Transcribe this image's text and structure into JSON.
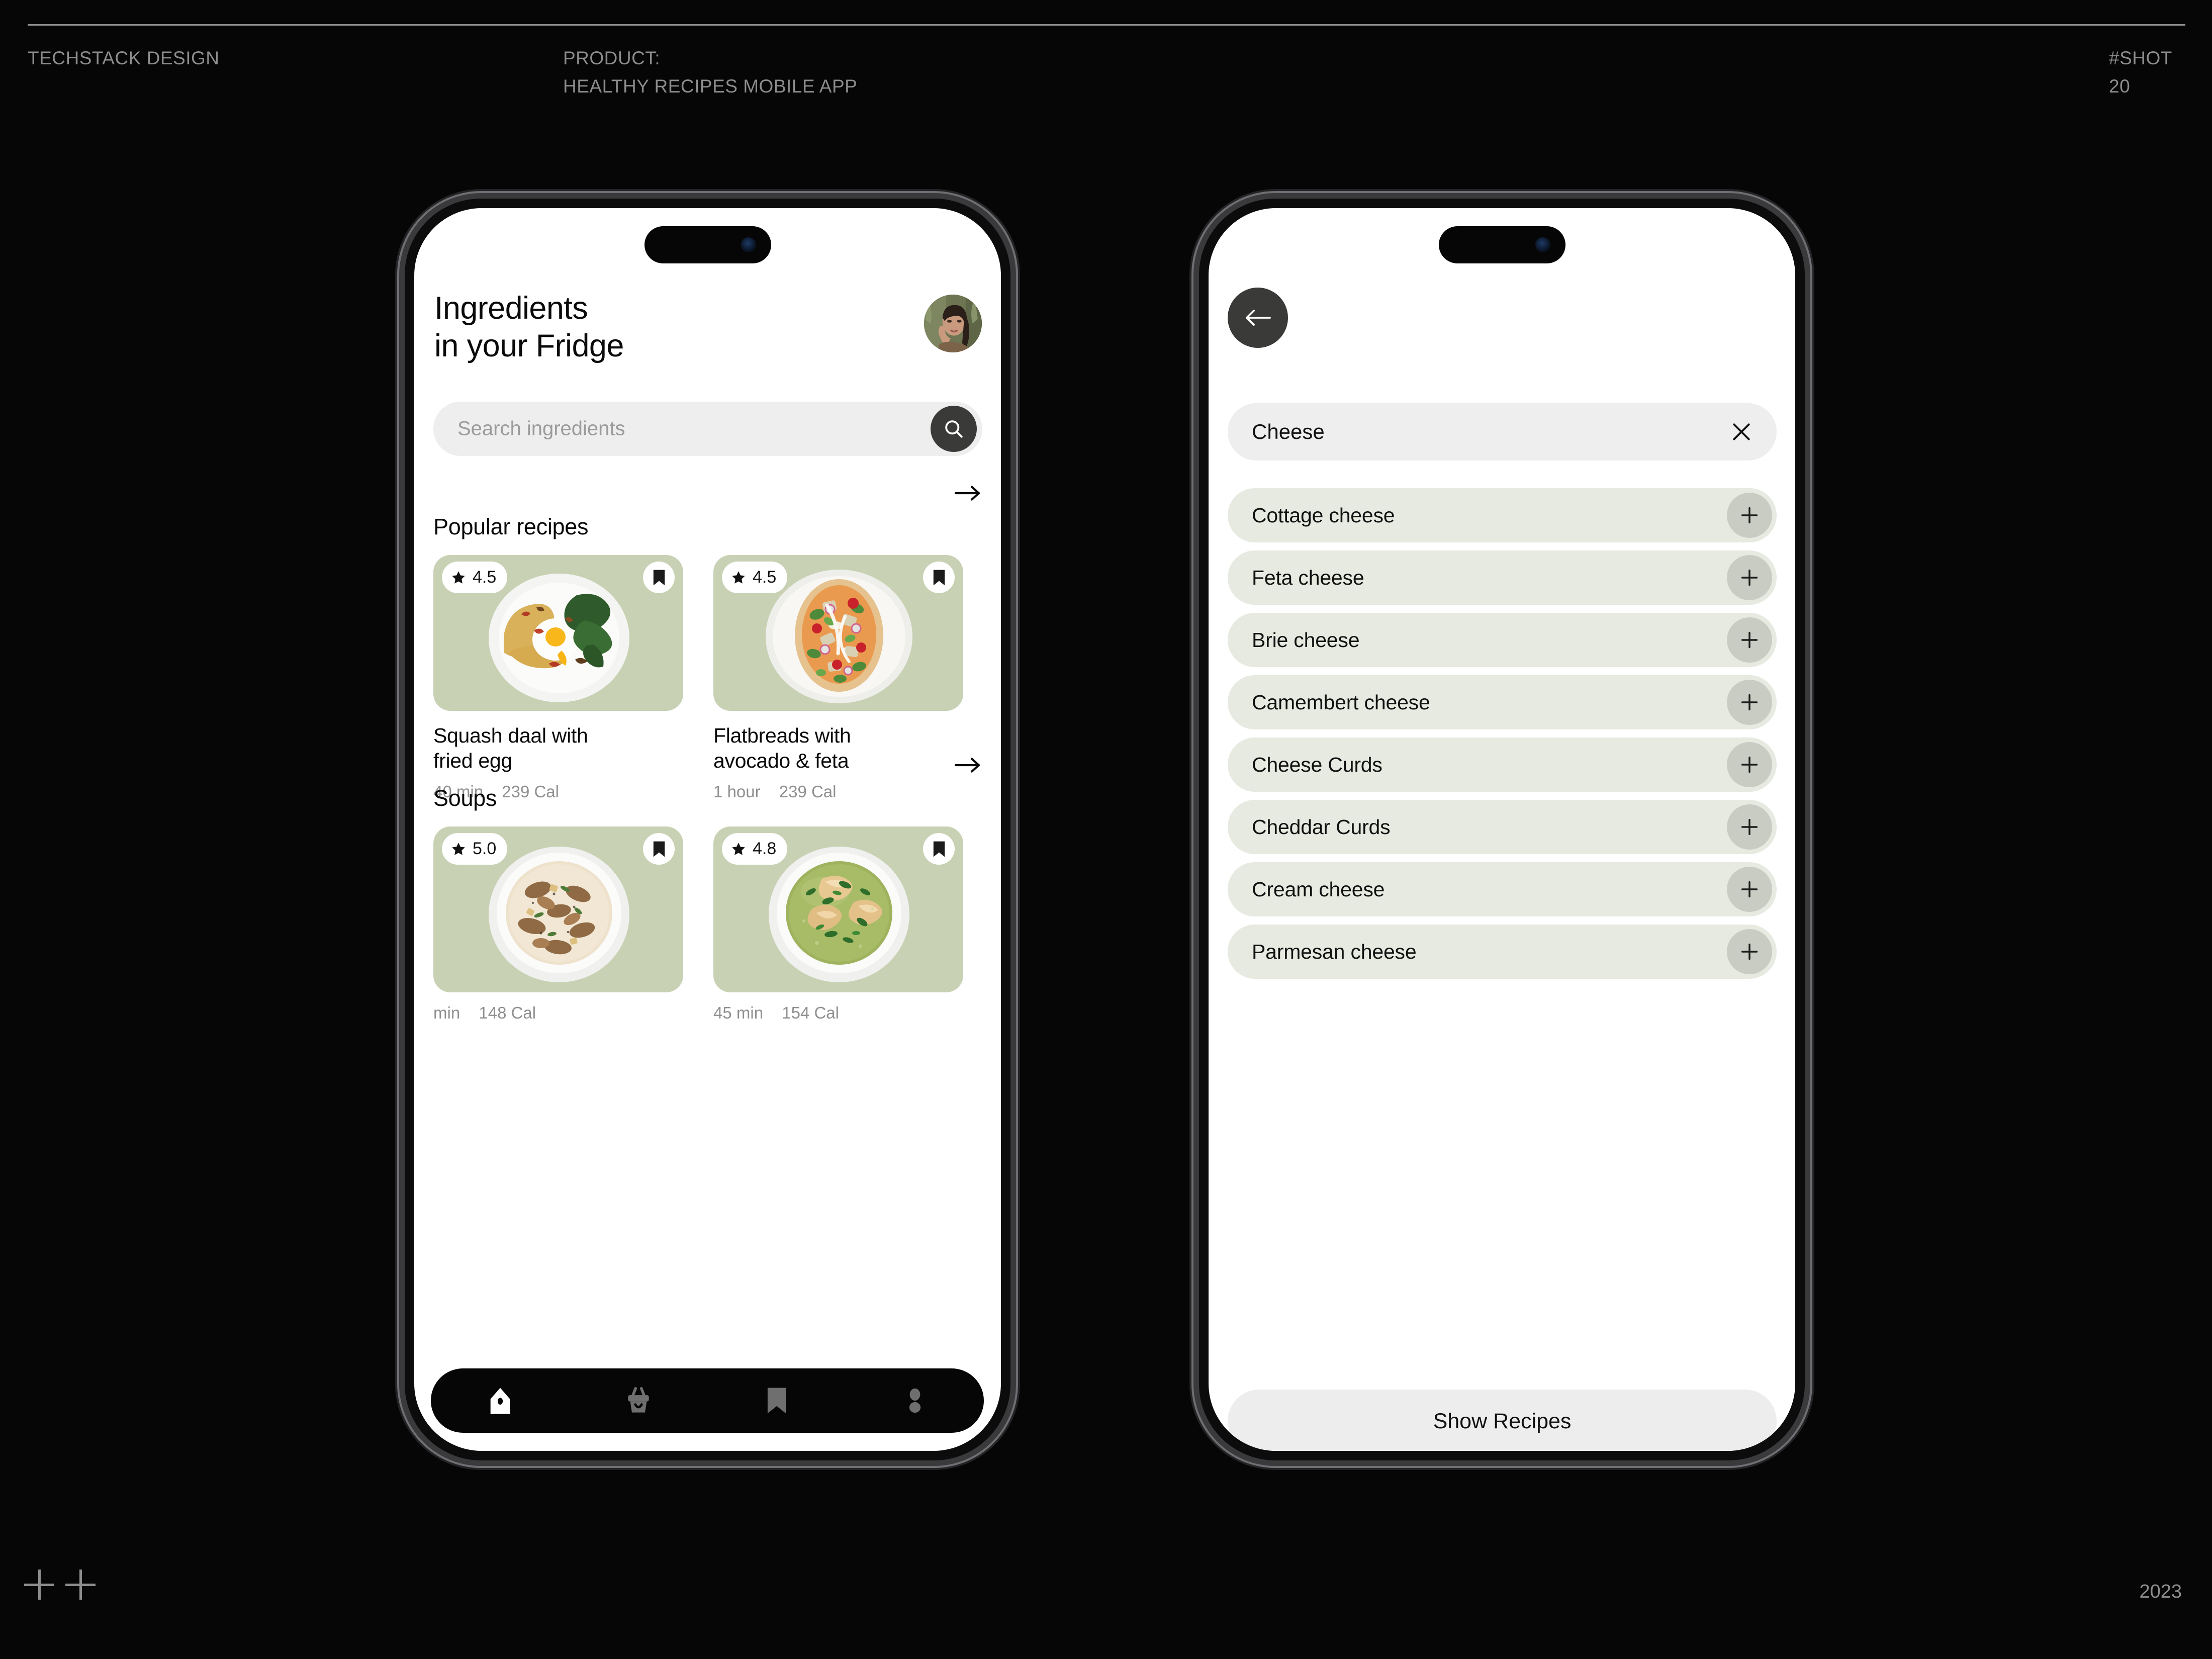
{
  "presentation": {
    "studio": "TECHSTACK DESIGN",
    "product_line": "PRODUCT:\nHEALTHY RECIPES MOBILE APP",
    "shot_label": "#SHOT\n20",
    "year": "2023"
  },
  "screen_home": {
    "title": "Ingredients\nin your Fridge",
    "avatar_alt": "user-avatar",
    "search": {
      "placeholder": "Search ingredients",
      "icon": "search-icon"
    },
    "sections": [
      {
        "heading": "Popular recipes",
        "cards": [
          {
            "rating": "4.5",
            "name": "Squash daal with\nfried egg",
            "time": "40 min",
            "calories": "239 Cal"
          },
          {
            "rating": "4.5",
            "name": "Flatbreads with\navocado & feta",
            "time": "1 hour",
            "calories": "239 Cal"
          }
        ]
      },
      {
        "heading": "Soups",
        "cards": [
          {
            "rating": "5.0",
            "name": "",
            "time": "min",
            "calories": "148 Cal"
          },
          {
            "rating": "4.8",
            "name": "",
            "time": "45 min",
            "calories": "154 Cal"
          }
        ]
      }
    ],
    "nav": [
      {
        "icon": "home-icon",
        "active": true
      },
      {
        "icon": "basket-icon",
        "active": false
      },
      {
        "icon": "bookmark-icon",
        "active": false
      },
      {
        "icon": "profile-icon",
        "active": false
      }
    ]
  },
  "screen_search": {
    "back_icon": "arrow-left-icon",
    "query": "Cheese",
    "clear_icon": "close-icon",
    "ingredients": [
      {
        "label": "Cottage cheese"
      },
      {
        "label": "Feta cheese"
      },
      {
        "label": "Brie cheese"
      },
      {
        "label": "Camembert cheese"
      },
      {
        "label": "Cheese Curds"
      },
      {
        "label": "Cheddar Curds"
      },
      {
        "label": "Cream cheese"
      },
      {
        "label": "Parmesan cheese"
      }
    ],
    "cta_label": "Show Recipes"
  },
  "colors": {
    "background": "#060606",
    "card_green": "#c8d1b3",
    "row_green": "#e7eae0",
    "dark_pill": "#3a3a38",
    "muted_text": "#8d8d8d"
  }
}
